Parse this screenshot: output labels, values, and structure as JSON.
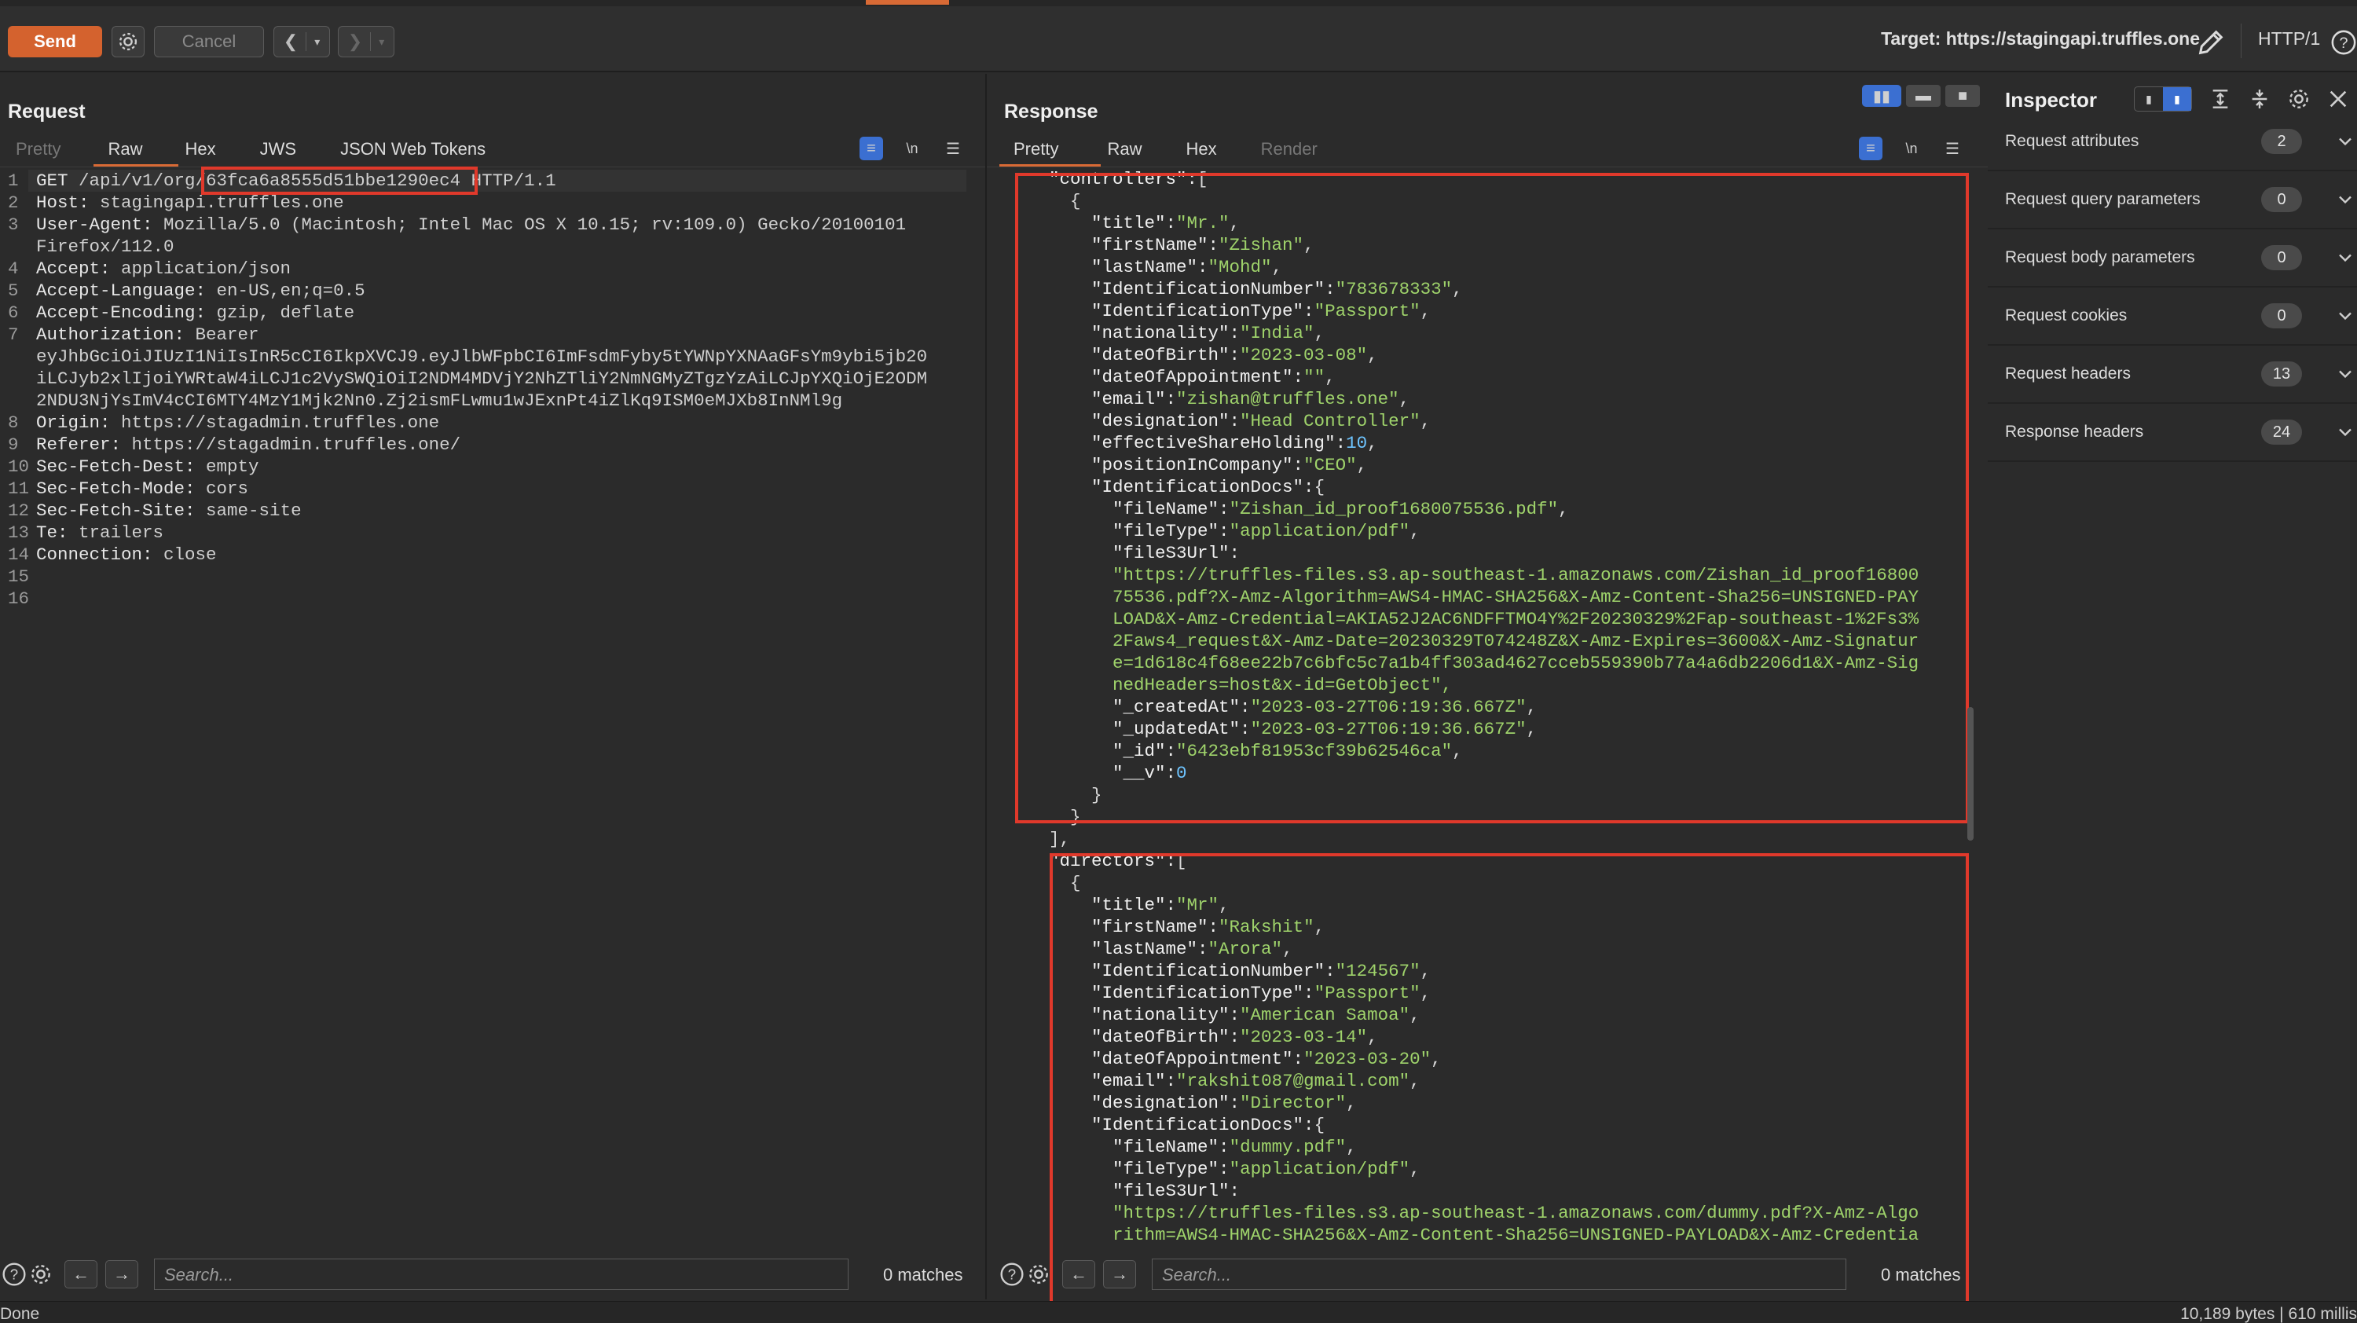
{
  "toolbar": {
    "send": "Send",
    "cancel": "Cancel",
    "target": "Target: https://stagingapi.truffles.one",
    "http_version": "HTTP/1"
  },
  "request": {
    "title": "Request",
    "tabs": [
      "Pretty",
      "Raw",
      "Hex",
      "JWS",
      "JSON Web Tokens"
    ],
    "active_tab": "Raw",
    "line_numbers": [
      "1",
      "2",
      "3",
      "",
      "4",
      "5",
      "6",
      "7",
      "",
      "",
      "",
      "8",
      "9",
      "10",
      "11",
      "12",
      "13",
      "14",
      "15",
      "16"
    ],
    "lines": [
      {
        "name": "GET",
        "value": " /api/v1/org/63fca6a8555d51bbe1290ec4 HTTP/1.1"
      },
      {
        "name": "Host:",
        "value": " stagingapi.truffles.one"
      },
      {
        "name": "User-Agent:",
        "value": " Mozilla/5.0 (Macintosh; Intel Mac OS X 10.15; rv:109.0) Gecko/20100101"
      },
      {
        "name": "",
        "value": "Firefox/112.0"
      },
      {
        "name": "Accept:",
        "value": " application/json"
      },
      {
        "name": "Accept-Language:",
        "value": " en-US,en;q=0.5"
      },
      {
        "name": "Accept-Encoding:",
        "value": " gzip, deflate"
      },
      {
        "name": "Authorization:",
        "value": " Bearer"
      },
      {
        "name": "",
        "value": "eyJhbGciOiJIUzI1NiIsInR5cCI6IkpXVCJ9.eyJlbWFpbCI6ImFsdmFyby5tYWNpYXNAaGFsYm9ybi5jb20"
      },
      {
        "name": "",
        "value": "iLCJyb2xlIjoiYWRtaW4iLCJ1c2VySWQiOiI2NDM4MDVjY2NhZTliY2NmNGMyZTgzYzAiLCJpYXQiOjE2ODM"
      },
      {
        "name": "",
        "value": "2NDU3NjYsImV4cCI6MTY4MzY1Mjk2Nn0.Zj2ismFLwmu1wJExnPt4iZlKq9ISM0eMJXb8InNMl9g"
      },
      {
        "name": "Origin:",
        "value": " https://stagadmin.truffles.one"
      },
      {
        "name": "Referer:",
        "value": " https://stagadmin.truffles.one/"
      },
      {
        "name": "Sec-Fetch-Dest:",
        "value": " empty"
      },
      {
        "name": "Sec-Fetch-Mode:",
        "value": " cors"
      },
      {
        "name": "Sec-Fetch-Site:",
        "value": " same-site"
      },
      {
        "name": "Te:",
        "value": " trailers"
      },
      {
        "name": "Connection:",
        "value": " close"
      },
      {
        "name": "",
        "value": ""
      },
      {
        "name": "",
        "value": ""
      }
    ],
    "search_placeholder": "Search...",
    "matches": "0 matches"
  },
  "response": {
    "title": "Response",
    "tabs": [
      "Pretty",
      "Raw",
      "Hex",
      "Render"
    ],
    "active_tab": "Pretty",
    "lines": [
      "  \"controllers\":[",
      "    {",
      "      \"title\":\"Mr.\",",
      "      \"firstName\":\"Zishan\",",
      "      \"lastName\":\"Mohd\",",
      "      \"IdentificationNumber\":\"783678333\",",
      "      \"IdentificationType\":\"Passport\",",
      "      \"nationality\":\"India\",",
      "      \"dateOfBirth\":\"2023-03-08\",",
      "      \"dateOfAppointment\":\"\",",
      "      \"email\":\"zishan@truffles.one\",",
      "      \"designation\":\"Head Controller\",",
      "      \"effectiveShareHolding\":10,",
      "      \"positionInCompany\":\"CEO\",",
      "      \"IdentificationDocs\":{",
      "        \"fileName\":\"Zishan_id_proof1680075536.pdf\",",
      "        \"fileType\":\"application/pdf\",",
      "        \"fileS3Url\":",
      "        \"https://truffles-files.s3.ap-southeast-1.amazonaws.com/Zishan_id_proof16800",
      "        75536.pdf?X-Amz-Algorithm=AWS4-HMAC-SHA256&X-Amz-Content-Sha256=UNSIGNED-PAY",
      "        LOAD&X-Amz-Credential=AKIA52J2AC6NDFFTMO4Y%2F20230329%2Fap-southeast-1%2Fs3%",
      "        2Faws4_request&X-Amz-Date=20230329T074248Z&X-Amz-Expires=3600&X-Amz-Signatur",
      "        e=1d618c4f68ee22b7c6bfc5c7a1b4ff303ad4627cceb559390b77a4a6db2206d1&X-Amz-Sig",
      "        nedHeaders=host&x-id=GetObject\",",
      "        \"_createdAt\":\"2023-03-27T06:19:36.667Z\",",
      "        \"_updatedAt\":\"2023-03-27T06:19:36.667Z\",",
      "        \"_id\":\"6423ebf81953cf39b62546ca\",",
      "        \"__v\":0",
      "      }",
      "    }",
      "  ],",
      "  \"directors\":[",
      "    {",
      "      \"title\":\"Mr\",",
      "      \"firstName\":\"Rakshit\",",
      "      \"lastName\":\"Arora\",",
      "      \"IdentificationNumber\":\"124567\",",
      "      \"IdentificationType\":\"Passport\",",
      "      \"nationality\":\"American Samoa\",",
      "      \"dateOfBirth\":\"2023-03-14\",",
      "      \"dateOfAppointment\":\"2023-03-20\",",
      "      \"email\":\"rakshit087@gmail.com\",",
      "      \"designation\":\"Director\",",
      "      \"IdentificationDocs\":{",
      "        \"fileName\":\"dummy.pdf\",",
      "        \"fileType\":\"application/pdf\",",
      "        \"fileS3Url\":",
      "        \"https://truffles-files.s3.ap-southeast-1.amazonaws.com/dummy.pdf?X-Amz-Algo",
      "        rithm=AWS4-HMAC-SHA256&X-Amz-Content-Sha256=UNSIGNED-PAYLOAD&X-Amz-Credentia"
    ],
    "search_placeholder": "Search...",
    "matches": "0 matches"
  },
  "inspector": {
    "title": "Inspector",
    "rows": [
      {
        "label": "Request attributes",
        "count": "2"
      },
      {
        "label": "Request query parameters",
        "count": "0"
      },
      {
        "label": "Request body parameters",
        "count": "0"
      },
      {
        "label": "Request cookies",
        "count": "0"
      },
      {
        "label": "Request headers",
        "count": "13"
      },
      {
        "label": "Response headers",
        "count": "24"
      }
    ]
  },
  "status": {
    "left": "Done",
    "right": "10,189 bytes | 610 millis"
  },
  "colors": {
    "accent": "#d86a35",
    "highlight_box": "#e0392b",
    "json_string": "#9fd36b",
    "json_number": "#6ec4ff"
  }
}
